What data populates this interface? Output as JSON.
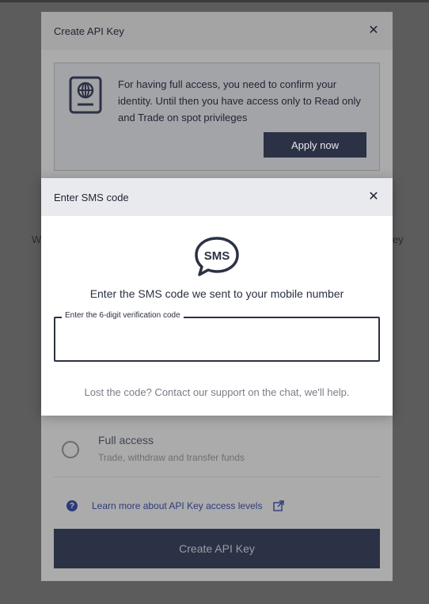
{
  "background": {
    "left_fragment": "W",
    "right_fragment": "ey"
  },
  "create_modal": {
    "title": "Create API Key",
    "notice_text": "For having full access, you need to confirm your identity. Until then you have access only to Read only and Trade on spot privileges",
    "apply_label": "Apply now",
    "full_access_title": "Full access",
    "full_access_subtitle": "Trade, withdraw and transfer funds",
    "learn_more_label": "Learn more about API Key access levels",
    "create_button_label": "Create API Key"
  },
  "sms_modal": {
    "title": "Enter SMS code",
    "icon_text": "SMS",
    "instruction": "Enter the SMS code we sent to your mobile number",
    "field_label": "Enter the 6-digit verification code",
    "field_value": "",
    "lost_code_text": "Lost the code? Contact our support on the chat, we'll help."
  },
  "icons": [
    "close-icon",
    "passport-icon",
    "sms-bubble-icon",
    "help-icon",
    "external-link-icon"
  ],
  "colors": {
    "primary_dark": "#2c3245",
    "link": "#2d3b7c",
    "overlay": "#5c5c5c"
  }
}
